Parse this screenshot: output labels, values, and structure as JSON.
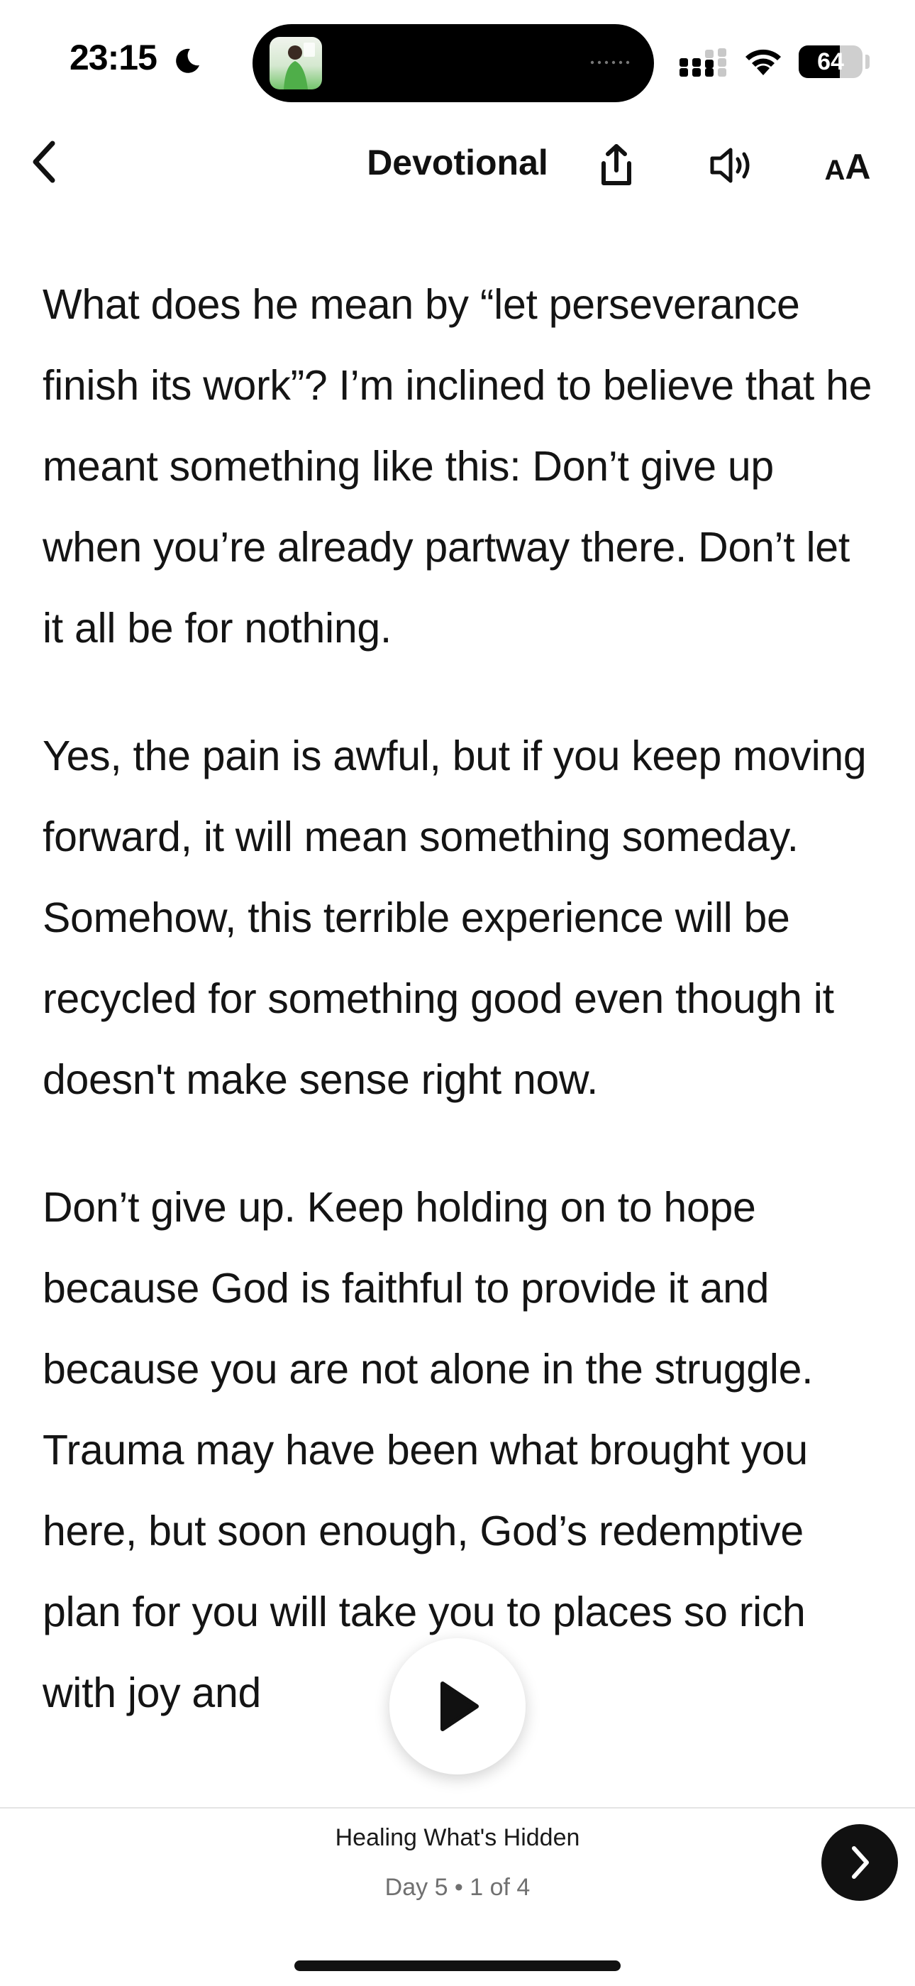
{
  "status_bar": {
    "time": "23:15",
    "battery_level": "64",
    "battery_fraction": 0.64,
    "icons": [
      "moon-icon",
      "now-playing-artwork",
      "signal-icon",
      "wifi-icon",
      "battery-icon"
    ]
  },
  "nav": {
    "title": "Devotional",
    "back_icon": "chevron-left-icon",
    "share_icon": "share-icon",
    "audio_icon": "speaker-icon",
    "text_size_small": "A",
    "text_size_large": "A"
  },
  "content": {
    "paragraphs": [
      "What does he mean by “let perseverance finish its work”? I’m inclined to believe that he meant something like this: Don’t give up when you’re already partway there. Don’t let it all be for nothing.",
      "Yes, the pain is awful, but if you keep moving forward, it will mean something someday. Somehow, this terrible experience will be recycled for something good even though it doesn't make sense right now.",
      "Don’t give up. Keep holding on to hope because God is faithful to provide it and because you are not alone in the struggle. Trauma may have been what brought you here, but soon enough, God’s redemptive plan for you will take you to places so rich with joy and"
    ]
  },
  "player": {
    "play_icon": "play-icon"
  },
  "footer": {
    "plan_title": "Healing What's Hidden",
    "day_label": "Day 5 • 1 of 4",
    "next_icon": "chevron-right-icon"
  },
  "colors": {
    "text": "#141414",
    "background": "#ffffff",
    "secondary_text": "#707070",
    "next_button": "#111111"
  }
}
